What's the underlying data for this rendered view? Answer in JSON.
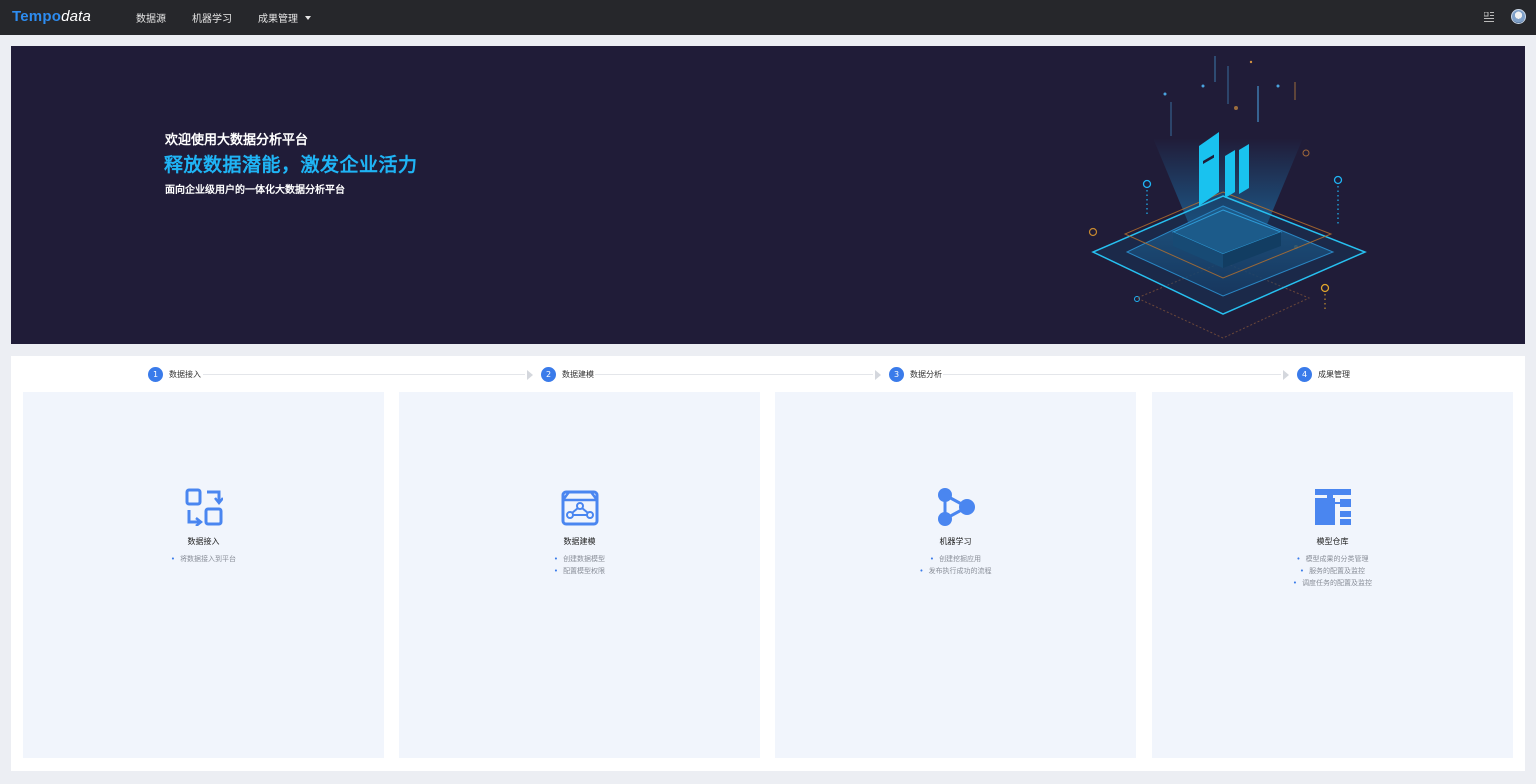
{
  "header": {
    "logo_part1": "Tempo",
    "logo_part2": "data",
    "nav": [
      {
        "label": "数据源"
      },
      {
        "label": "机器学习"
      },
      {
        "label": "成果管理",
        "has_dropdown": true
      }
    ],
    "icons": [
      "apps-grid-icon",
      "user-avatar"
    ]
  },
  "banner": {
    "welcome": "欢迎使用大数据分析平台",
    "slogan": "释放数据潜能，激发企业活力",
    "subtitle": "面向企业级用户的一体化大数据分析平台"
  },
  "steps": [
    {
      "num": "1",
      "label": "数据接入"
    },
    {
      "num": "2",
      "label": "数据建模"
    },
    {
      "num": "3",
      "label": "数据分析"
    },
    {
      "num": "4",
      "label": "成果管理"
    }
  ],
  "cards": [
    {
      "title": "数据接入",
      "icon": "data-access-icon",
      "items": [
        "将数据接入到平台"
      ]
    },
    {
      "title": "数据建模",
      "icon": "data-modeling-icon",
      "items": [
        "创建数据模型",
        "配置模型权限"
      ]
    },
    {
      "title": "机器学习",
      "icon": "machine-learning-icon",
      "items": [
        "创建挖掘应用",
        "发布执行成功的流程"
      ]
    },
    {
      "title": "模型仓库",
      "icon": "model-warehouse-icon",
      "items": [
        "模型成果的分类管理",
        "服务的配置及监控",
        "调度任务的配置及监控"
      ]
    }
  ],
  "colors": {
    "topbar": "#26272b",
    "banner_bg": "#201c38",
    "accent": "#3a7bea",
    "slogan": "#1fb4f5",
    "card_bg": "#f1f5fc"
  }
}
